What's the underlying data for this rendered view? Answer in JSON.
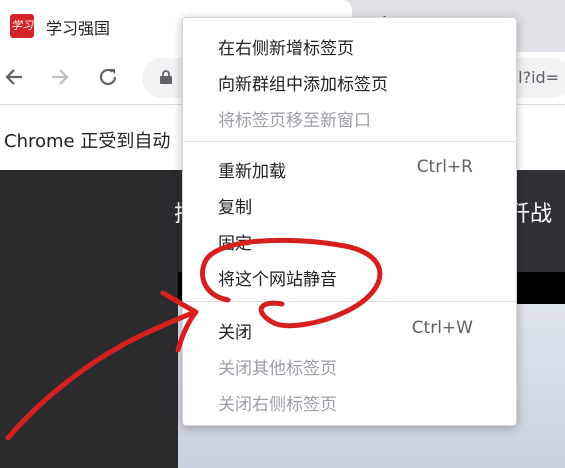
{
  "tab": {
    "title": "学习强国",
    "favicon_text": "学习"
  },
  "toolbar": {
    "url_fragment": "nl?id="
  },
  "infobar": {
    "text": "Chrome 正受到自动"
  },
  "page": {
    "banner_left": "把",
    "banner_right": "歼战"
  },
  "menu": {
    "items": [
      {
        "label": "在右侧新增标签页",
        "shortcut": "",
        "enabled": true
      },
      {
        "label": "向新群组中添加标签页",
        "shortcut": "",
        "enabled": true
      },
      {
        "label": "将标签页移至新窗口",
        "shortcut": "",
        "enabled": false
      },
      {
        "label": "重新加载",
        "shortcut": "Ctrl+R",
        "enabled": true
      },
      {
        "label": "复制",
        "shortcut": "",
        "enabled": true
      },
      {
        "label": "固定",
        "shortcut": "",
        "enabled": true
      },
      {
        "label": "将这个网站静音",
        "shortcut": "",
        "enabled": true
      },
      {
        "label": "关闭",
        "shortcut": "Ctrl+W",
        "enabled": true
      },
      {
        "label": "关闭其他标签页",
        "shortcut": "",
        "enabled": false
      },
      {
        "label": "关闭右侧标签页",
        "shortcut": "",
        "enabled": false
      }
    ]
  },
  "colors": {
    "annotation": "#d6201f",
    "favicon": "#d6232a"
  }
}
